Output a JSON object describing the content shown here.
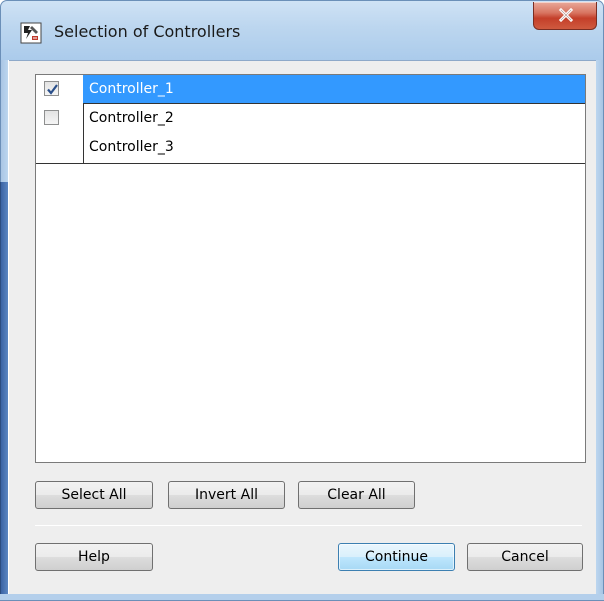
{
  "window": {
    "title": "Selection of Controllers",
    "title_icon": "controller-app-icon",
    "close_icon": "close-icon"
  },
  "controllers": [
    {
      "name": "Controller_1",
      "checked": true,
      "selected": true,
      "has_checkbox": true
    },
    {
      "name": "Controller_2",
      "checked": false,
      "selected": false,
      "has_checkbox": true
    },
    {
      "name": "Controller_3",
      "checked": false,
      "selected": false,
      "has_checkbox": false
    }
  ],
  "selection_buttons": {
    "select_all": "Select All",
    "invert_all": "Invert All",
    "clear_all": "Clear All"
  },
  "footer_buttons": {
    "help": "Help",
    "continue": "Continue",
    "cancel": "Cancel"
  },
  "colors": {
    "selection": "#3399ff",
    "dialog_background": "#eeeeee",
    "close_button": "#c43f2a"
  }
}
